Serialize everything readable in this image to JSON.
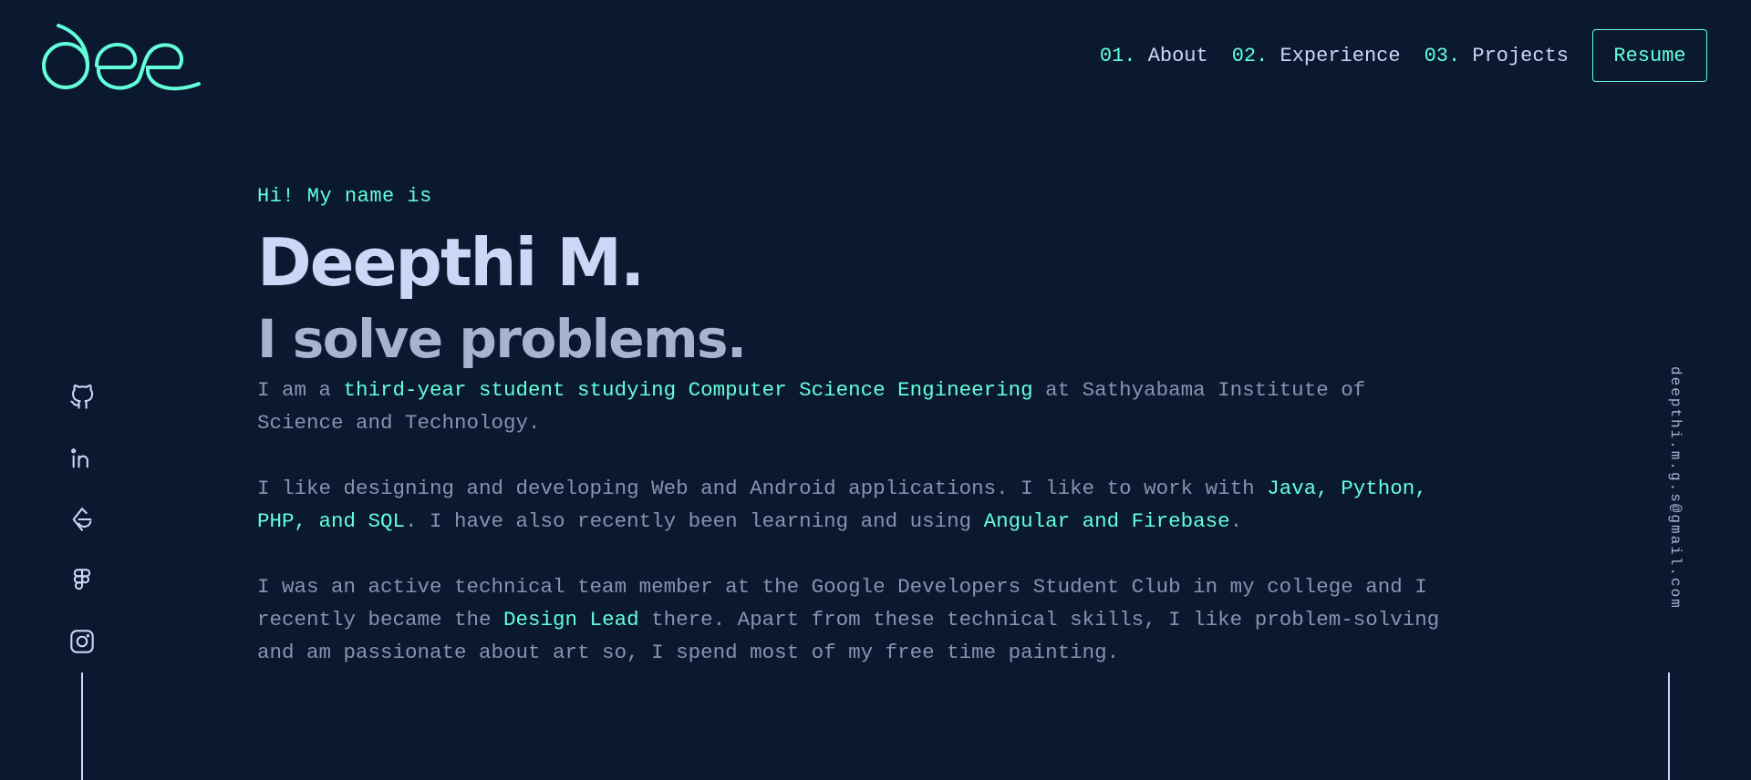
{
  "logo": {
    "text": "dee",
    "color": "#64ffda"
  },
  "nav": {
    "items": [
      {
        "num": "01.",
        "label": "About"
      },
      {
        "num": "02.",
        "label": "Experience"
      },
      {
        "num": "03.",
        "label": "Projects"
      }
    ],
    "resume_label": "Resume"
  },
  "hero": {
    "greeting": "Hi! My name is",
    "name": "Deepthi M.",
    "tagline": "I solve problems.",
    "bio1": {
      "a": "I am a ",
      "b": "third-year student studying Computer Science Engineering",
      "c": " at Sathyabama Institute of Science and Technology."
    },
    "bio2": {
      "a": "I like designing and developing Web and Android applications. I like to work with ",
      "b": "Java, Python, PHP, and SQL",
      "c": ". I have also recently been learning and using ",
      "d": "Angular and Firebase",
      "e": "."
    },
    "bio3": {
      "a": "I was an active technical team member at the Google Developers Student Club in my college and I recently became the ",
      "b": "Design Lead",
      "c": " there. Apart from these technical skills, I like problem-solving and am passionate about art so, I spend most of my free time painting."
    }
  },
  "socials": [
    "github-icon",
    "linkedin-icon",
    "codechef-icon",
    "figma-icon",
    "instagram-icon"
  ],
  "email": "deepthi.m.g.s@gmail.com",
  "colors": {
    "background": "#0a1930",
    "accent": "#64ffda",
    "heading": "#ccd6f6",
    "body_text": "#8892b0"
  }
}
